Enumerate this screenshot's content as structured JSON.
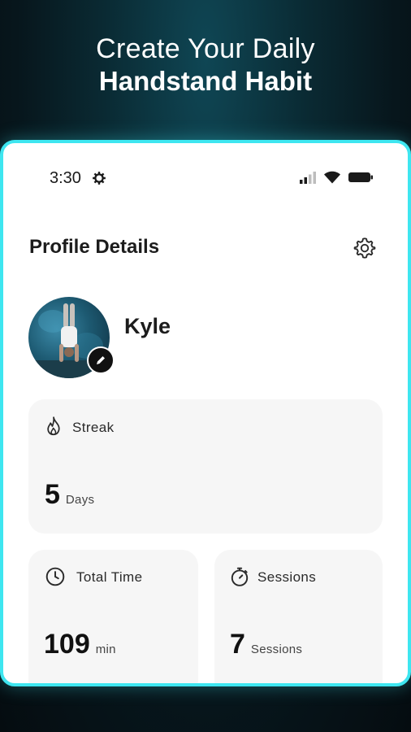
{
  "headline": {
    "line1": "Create Your Daily",
    "line2": "Handstand Habit"
  },
  "status_bar": {
    "time": "3:30",
    "icons": [
      "settings-gear-icon",
      "signal-icon",
      "wifi-icon",
      "battery-icon"
    ]
  },
  "profile": {
    "title": "Profile Details",
    "settings_icon": "gear-icon",
    "user_name": "Kyle",
    "edit_icon": "pencil-icon"
  },
  "stats": {
    "streak": {
      "label": "Streak",
      "icon": "flame-icon",
      "value": "5",
      "unit": "Days"
    },
    "total_time": {
      "label": "Total Time",
      "icon": "clock-icon",
      "value": "109",
      "unit": "min"
    },
    "sessions": {
      "label": "Sessions",
      "icon": "stopwatch-icon",
      "value": "7",
      "unit": "Sessions"
    }
  },
  "colors": {
    "frame_border": "#3ee6f0",
    "card_bg": "#f6f6f6",
    "text_dark": "#1c1c1c"
  }
}
